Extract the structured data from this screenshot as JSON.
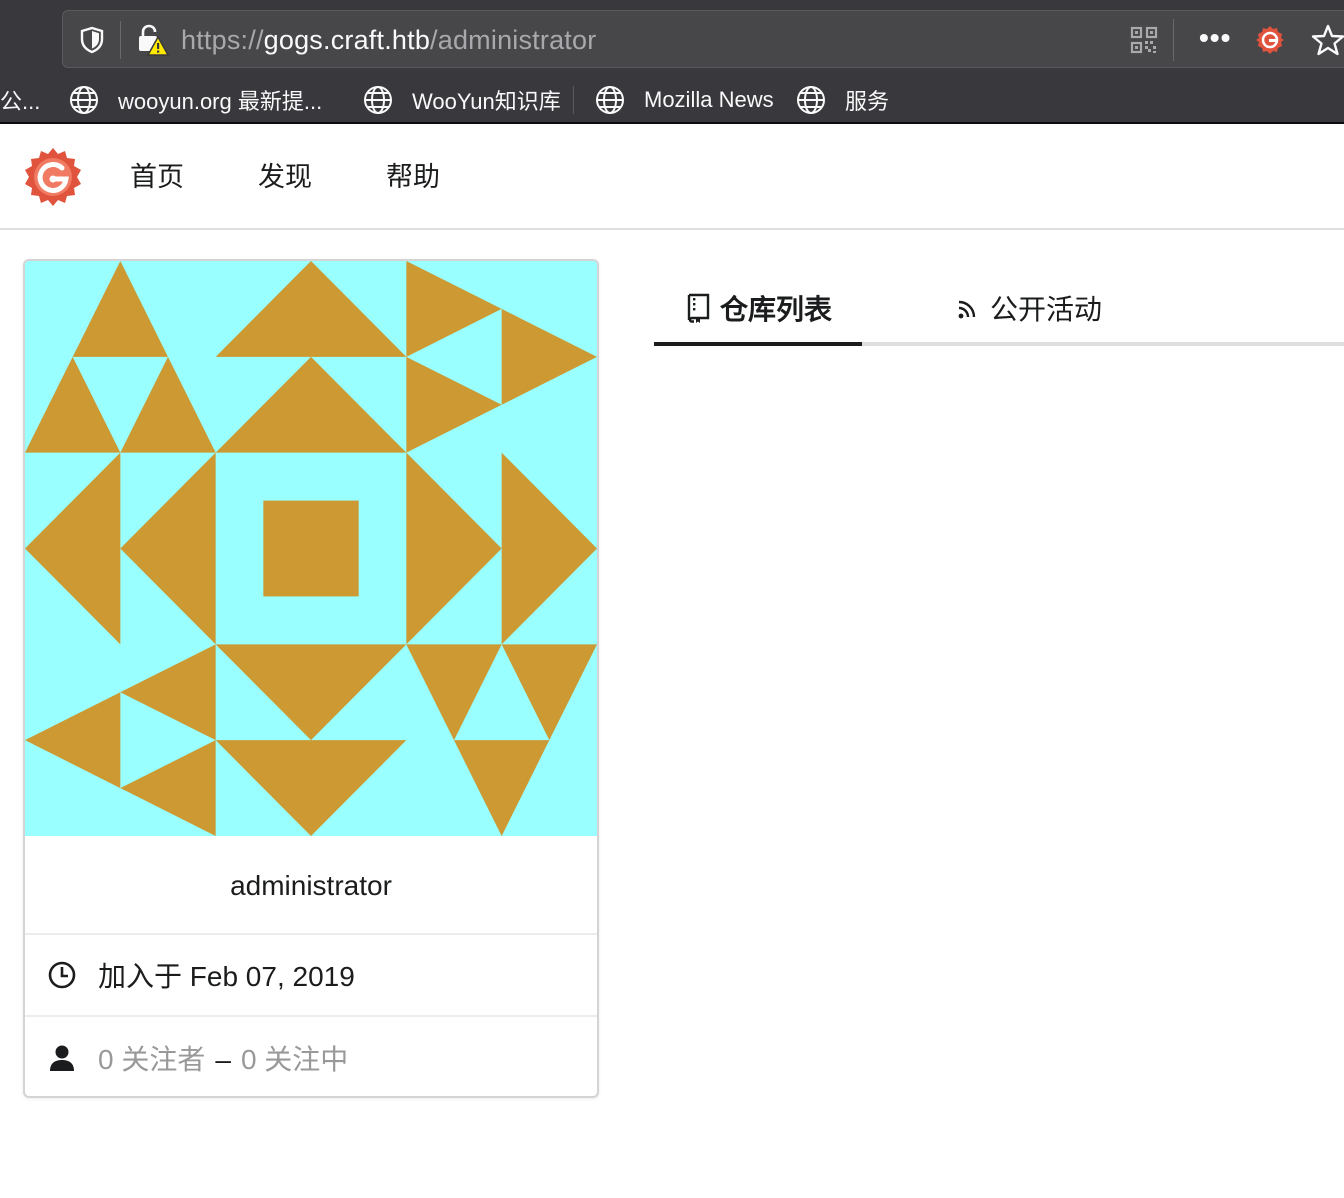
{
  "browser": {
    "url_scheme": "https://",
    "url_host": "gogs.craft.htb",
    "url_path": "/administrator",
    "more_label": "•••",
    "bookmarks": [
      {
        "label": "公..."
      },
      {
        "label": "wooyun.org 最新提..."
      },
      {
        "label": "WooYun知识库"
      },
      {
        "label": "Mozilla News"
      },
      {
        "label": "服务"
      }
    ]
  },
  "nav": {
    "home": "首页",
    "explore": "发现",
    "help": "帮助"
  },
  "profile": {
    "username": "administrator",
    "joined": "加入于 Feb 07, 2019",
    "followers": "0 关注者",
    "dash": "–",
    "following": "0 关注中"
  },
  "tabs": {
    "repositories": "仓库列表",
    "activity": "公开活动"
  },
  "colors": {
    "avatar_bg": "#99ffff",
    "avatar_fg": "#cc9933",
    "gogs_red": "#e0533c"
  }
}
